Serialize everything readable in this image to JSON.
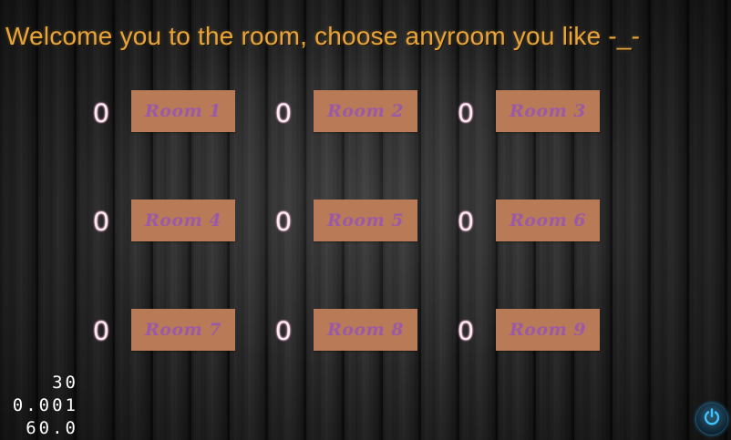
{
  "title": "Welcome you to the room, choose anyroom you like -_-",
  "rooms": [
    {
      "label": "Room 1",
      "count": "0"
    },
    {
      "label": "Room 2",
      "count": "0"
    },
    {
      "label": "Room 3",
      "count": "0"
    },
    {
      "label": "Room 4",
      "count": "0"
    },
    {
      "label": "Room 5",
      "count": "0"
    },
    {
      "label": "Room 6",
      "count": "0"
    },
    {
      "label": "Room 7",
      "count": "0"
    },
    {
      "label": "Room 8",
      "count": "0"
    },
    {
      "label": "Room 9",
      "count": "0"
    }
  ],
  "stats": [
    "30",
    "0.001",
    "60.0"
  ],
  "icons": {
    "power": "power-icon"
  },
  "colors": {
    "title": "#e8a33a",
    "room_button": "#b97a58",
    "room_label": "#9b5aa6",
    "count": "#fbeaf0",
    "power_glow": "#2aa6e8"
  }
}
